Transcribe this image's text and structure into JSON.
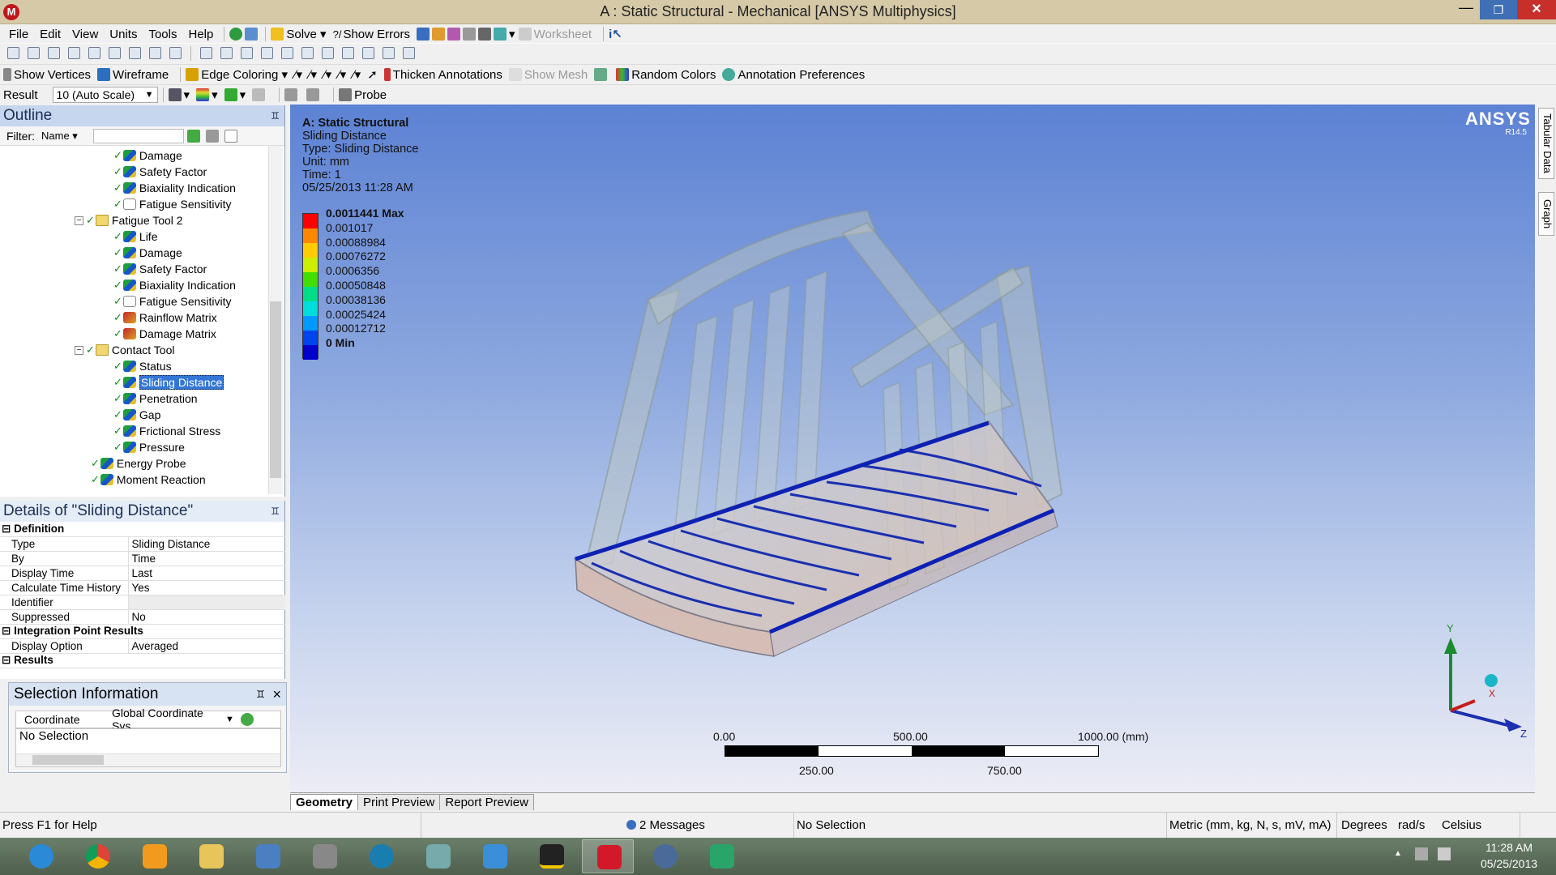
{
  "window": {
    "title": "A : Static Structural - Mechanical [ANSYS Multiphysics]",
    "logo": "M"
  },
  "menu": [
    "File",
    "Edit",
    "View",
    "Units",
    "Tools",
    "Help"
  ],
  "toolbar1": {
    "solve": "Solve",
    "show_errors": "Show Errors",
    "worksheet": "Worksheet"
  },
  "toolbar3": {
    "show_vertices": "Show Vertices",
    "wireframe": "Wireframe",
    "edge_coloring": "Edge Coloring",
    "thicken_annotations": "Thicken Annotations",
    "show_mesh": "Show Mesh",
    "random_colors": "Random Colors",
    "annotation_preferences": "Annotation Preferences"
  },
  "toolbar4": {
    "result_label": "Result",
    "result_scale": "10 (Auto Scale)",
    "probe": "Probe"
  },
  "outline": {
    "title": "Outline",
    "filter_label": "Filter:",
    "filter_value": "Name",
    "items": [
      {
        "label": "Damage",
        "kind": "result"
      },
      {
        "label": "Safety Factor",
        "kind": "result"
      },
      {
        "label": "Biaxiality Indication",
        "kind": "result"
      },
      {
        "label": "Fatigue Sensitivity",
        "kind": "plot"
      },
      {
        "label": "Fatigue Tool 2",
        "kind": "folder"
      },
      {
        "label": "Life",
        "kind": "result"
      },
      {
        "label": "Damage",
        "kind": "result"
      },
      {
        "label": "Safety Factor",
        "kind": "result"
      },
      {
        "label": "Biaxiality Indication",
        "kind": "result"
      },
      {
        "label": "Fatigue Sensitivity",
        "kind": "plot"
      },
      {
        "label": "Rainflow Matrix",
        "kind": "matrix"
      },
      {
        "label": "Damage Matrix",
        "kind": "matrix"
      },
      {
        "label": "Contact Tool",
        "kind": "folder"
      },
      {
        "label": "Status",
        "kind": "result"
      },
      {
        "label": "Sliding Distance",
        "kind": "result",
        "selected": true
      },
      {
        "label": "Penetration",
        "kind": "result"
      },
      {
        "label": "Gap",
        "kind": "result"
      },
      {
        "label": "Frictional Stress",
        "kind": "result"
      },
      {
        "label": "Pressure",
        "kind": "result"
      },
      {
        "label": "Energy Probe",
        "kind": "probe"
      },
      {
        "label": "Moment Reaction",
        "kind": "probe"
      }
    ]
  },
  "details": {
    "title": "Details of \"Sliding Distance\"",
    "rows": [
      {
        "cat": "Definition"
      },
      {
        "k": "Type",
        "v": "Sliding Distance"
      },
      {
        "k": "By",
        "v": "Time"
      },
      {
        "k": "Display Time",
        "v": "Last"
      },
      {
        "k": "Calculate Time History",
        "v": "Yes"
      },
      {
        "k": "Identifier",
        "v": ""
      },
      {
        "k": "Suppressed",
        "v": "No"
      },
      {
        "cat": "Integration Point Results"
      },
      {
        "k": "Display Option",
        "v": "Averaged"
      },
      {
        "cat": "Results"
      }
    ]
  },
  "selection": {
    "title": "Selection Information",
    "coordinate_label": "Coordinate",
    "coordinate_value": "Global Coordinate Sys",
    "no_selection": "No Selection"
  },
  "plot_info": {
    "line1": "A: Static Structural",
    "line2": "Sliding Distance",
    "line3": "Type: Sliding Distance",
    "line4": "Unit: mm",
    "line5": "Time: 1",
    "line6": "05/25/2013 11:28 AM"
  },
  "legend": {
    "max_label": "0.0011441 Max",
    "values": [
      "0.001017",
      "0.00088984",
      "0.00076272",
      "0.0006356",
      "0.00050848",
      "0.00038136",
      "0.00025424",
      "0.00012712"
    ],
    "min_label": "0 Min",
    "colors": [
      "#ff0000",
      "#ff8800",
      "#ffcc00",
      "#ccee00",
      "#44dd00",
      "#00dd88",
      "#00dddd",
      "#0099ff",
      "#0044ee",
      "#0000cc"
    ]
  },
  "brand": {
    "name": "ANSYS",
    "version": "R14.5"
  },
  "scale": {
    "t0": "0.00",
    "t500": "500.00",
    "t1000": "1000.00 (mm)",
    "t250": "250.00",
    "t750": "750.00"
  },
  "triad": {
    "x": "X",
    "y": "Y",
    "z": "Z"
  },
  "view_tabs": [
    "Geometry",
    "Print Preview",
    "Report Preview"
  ],
  "side_tabs": [
    "Tabular Data",
    "Graph"
  ],
  "status": {
    "help": "Press F1 for Help",
    "messages": "2 Messages",
    "selection": "No Selection",
    "units": "Metric (mm, kg, N, s, mV, mA)",
    "angle": "Degrees",
    "rot": "rad/s",
    "temp": "Celsius"
  },
  "clock": {
    "time": "11:28 AM",
    "date": "05/25/2013"
  }
}
